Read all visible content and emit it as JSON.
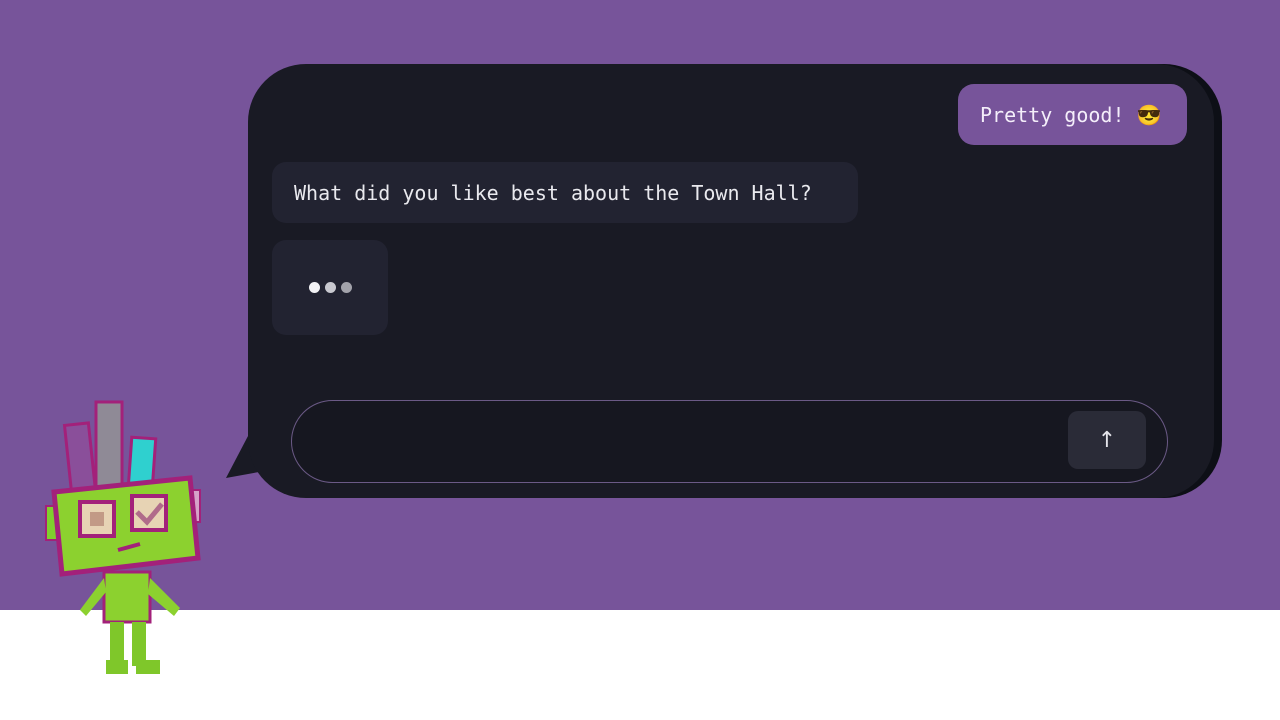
{
  "chat": {
    "messages": [
      {
        "role": "user",
        "text": "Pretty good! 😎"
      },
      {
        "role": "assistant",
        "text": "What did you like best about the Town Hall?"
      }
    ],
    "typing_indicator": true,
    "input": {
      "value": "",
      "placeholder": ""
    },
    "send_icon": "arrow-up-icon",
    "send_glyph": "↑"
  },
  "colors": {
    "background": "#77549a",
    "chat_panel": "#191a24",
    "user_bubble": "#77549a",
    "assistant_bubble": "#222331",
    "send_button": "#2a2b37"
  },
  "mascot": {
    "icon": "robot-mascot"
  }
}
